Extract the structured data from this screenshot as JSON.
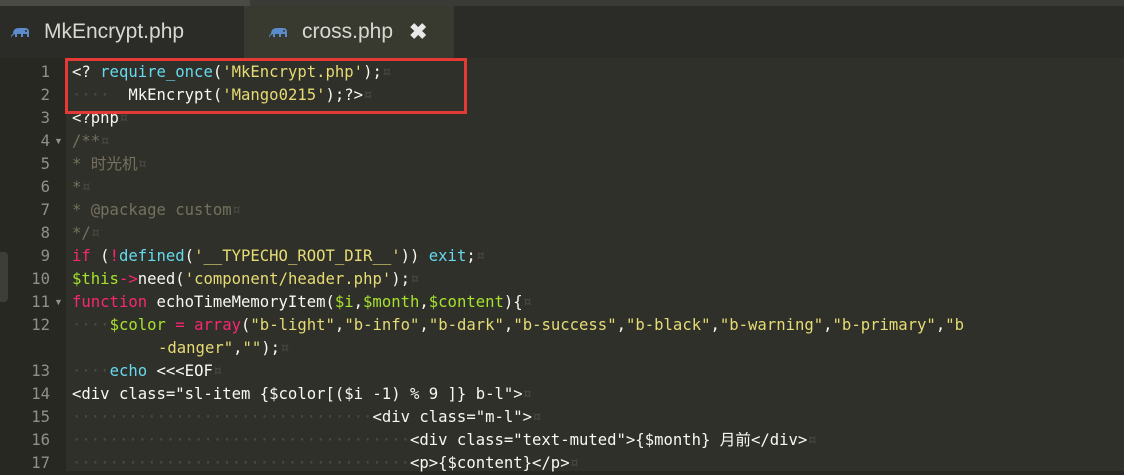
{
  "tabs": [
    {
      "label": "MkEncrypt.php",
      "icon": "php-elephant-icon"
    },
    {
      "label": "cross.php",
      "icon": "php-elephant-icon",
      "close": "✖"
    }
  ],
  "lines": [
    {
      "n": "1"
    },
    {
      "n": "2"
    },
    {
      "n": "3"
    },
    {
      "n": "4"
    },
    {
      "n": "5"
    },
    {
      "n": "6"
    },
    {
      "n": "7"
    },
    {
      "n": "8"
    },
    {
      "n": "9"
    },
    {
      "n": "10"
    },
    {
      "n": "11"
    },
    {
      "n": "12"
    },
    {
      "n": "13"
    },
    {
      "n": "14"
    },
    {
      "n": "15"
    },
    {
      "n": "16"
    },
    {
      "n": "17"
    }
  ],
  "code": {
    "l1": [
      "<?",
      " ",
      "require_once",
      "(",
      "'MkEncrypt.php'",
      ");",
      "¤"
    ],
    "l2": [
      "····",
      "  ",
      "MkEncrypt(",
      "'Mango0215'",
      ");?>",
      "¤"
    ],
    "l3": [
      "<?php",
      "¤"
    ],
    "l4": [
      "/**",
      "¤"
    ],
    "l5": [
      "* 时光机",
      "¤"
    ],
    "l6": [
      "*",
      "¤"
    ],
    "l7": [
      "* @package custom",
      "¤"
    ],
    "l8": [
      "*/",
      "¤"
    ],
    "l9": [
      "if",
      " (",
      "!",
      "defined",
      "(",
      "'__TYPECHO_ROOT_DIR__'",
      ")) ",
      "exit",
      ";",
      "¤"
    ],
    "l10": [
      "$this",
      "->",
      "need(",
      "'component/header.php'",
      ");",
      "¤"
    ],
    "l11": [
      "function",
      " echoTimeMemoryItem(",
      "$i",
      ",",
      "$month",
      ",",
      "$content",
      "){",
      "¤"
    ],
    "l12a": [
      "····",
      "$color",
      " = ",
      "array",
      "(",
      "\"b-light\"",
      ",",
      "\"b-info\"",
      ",",
      "\"b-dark\"",
      ",",
      "\"b-success\"",
      ",",
      "\"b-black\"",
      ",",
      "\"b-warning\"",
      ",",
      "\"b-primary\"",
      ",",
      "\"b"
    ],
    "l12b": [
      "-danger\"",
      ",",
      "\"\"",
      ");",
      "¤"
    ],
    "l13": [
      "····",
      "echo",
      " <<<EOF",
      "¤"
    ],
    "l14": [
      "<div class=\"sl-item {$color[($i -1) % 9 ]} b-l\">",
      "¤"
    ],
    "l15": [
      "································",
      "<div class=\"m-l\">",
      "¤"
    ],
    "l16": [
      "····································",
      "<div class=\"text-muted\">{$month} 月前</div>",
      "¤"
    ],
    "l17": [
      "····································",
      "<p>{$content}</p>",
      "¤"
    ]
  }
}
